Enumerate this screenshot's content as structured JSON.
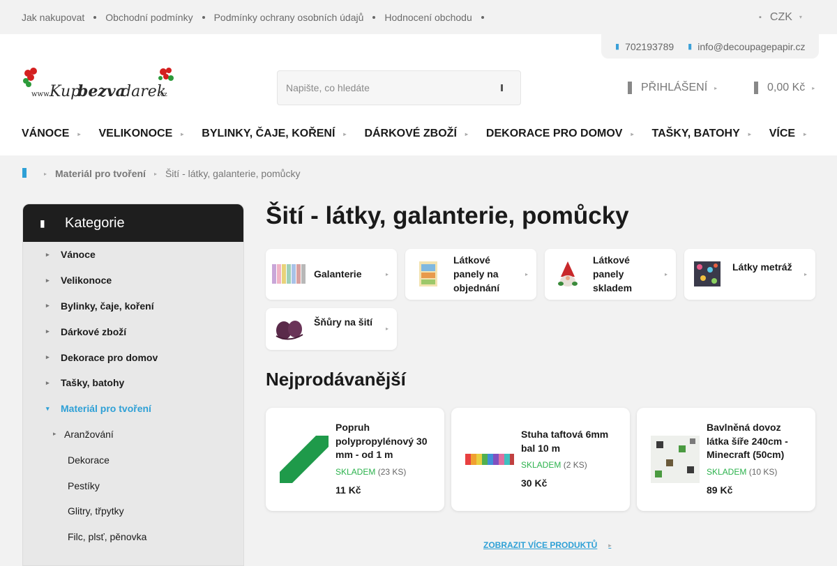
{
  "topbar": {
    "links": [
      "Jak nakupovat",
      "Obchodní podmínky",
      "Podmínky ochrany osobních údajů",
      "Hodnocení obchodu"
    ],
    "currency": "CZK"
  },
  "header": {
    "phone": "702193789",
    "email": "info@decoupagepapir.cz",
    "logo_text": "www.Kupbezvadarek.cz",
    "logo_colors": {
      "primary": "#2a2a2a",
      "accent": "#d42020",
      "leaf": "#2c9a3a"
    },
    "search_placeholder": "Napište, co hledáte",
    "login_label": "PŘIHLÁŠENÍ",
    "cart_total": "0,00 Kč"
  },
  "nav": [
    "VÁNOCE",
    "VELIKONOCE",
    "BYLINKY, ČAJE, KOŘENÍ",
    "DÁRKOVÉ ZBOŽÍ",
    "DEKORACE PRO DOMOV",
    "TAŠKY, BATOHY",
    "VÍCE"
  ],
  "breadcrumb": {
    "home_icon": "home-icon",
    "items": [
      "Materiál pro tvoření",
      "Šití - látky, galanterie, pomůcky"
    ]
  },
  "sidebar": {
    "title": "Kategorie",
    "items": [
      "Vánoce",
      "Velikonoce",
      "Bylinky, čaje, koření",
      "Dárkové zboží",
      "Dekorace pro domov",
      "Tašky, batohy"
    ],
    "active": "Materiál pro tvoření",
    "subitem": "Aranžování",
    "sub2": [
      "Dekorace",
      "Pestíky",
      "Glitry, třpytky",
      "Filc, plsť, pěnovka"
    ]
  },
  "main": {
    "title": "Šití - látky, galanterie, pomůcky",
    "subcategories": [
      "Galanterie",
      "Látkové panely na objednání",
      "Látkové panely skladem",
      "Látky metráž",
      "Šňůry na šití"
    ],
    "bestsellers_title": "Nejprodávanější",
    "products": [
      {
        "name": "Popruh polypropylénový 30 mm - od 1 m",
        "stock_label": "SKLADEM",
        "stock_count": "(23 KS)",
        "price": "11 Kč"
      },
      {
        "name": "Stuha taftová 6mm bal 10 m",
        "stock_label": "SKLADEM",
        "stock_count": "(2 KS)",
        "price": "30 Kč"
      },
      {
        "name": "Bavlněná dovoz látka šíře 240cm - Minecraft (50cm)",
        "stock_label": "SKLADEM",
        "stock_count": "(10 KS)",
        "price": "89 Kč"
      }
    ],
    "more_label": "ZOBRAZIT VÍCE PRODUKTŮ"
  },
  "colors": {
    "accent": "#2ea0d6",
    "stock_ok": "#2bb24c",
    "sidebar_head": "#1e1e1e"
  }
}
